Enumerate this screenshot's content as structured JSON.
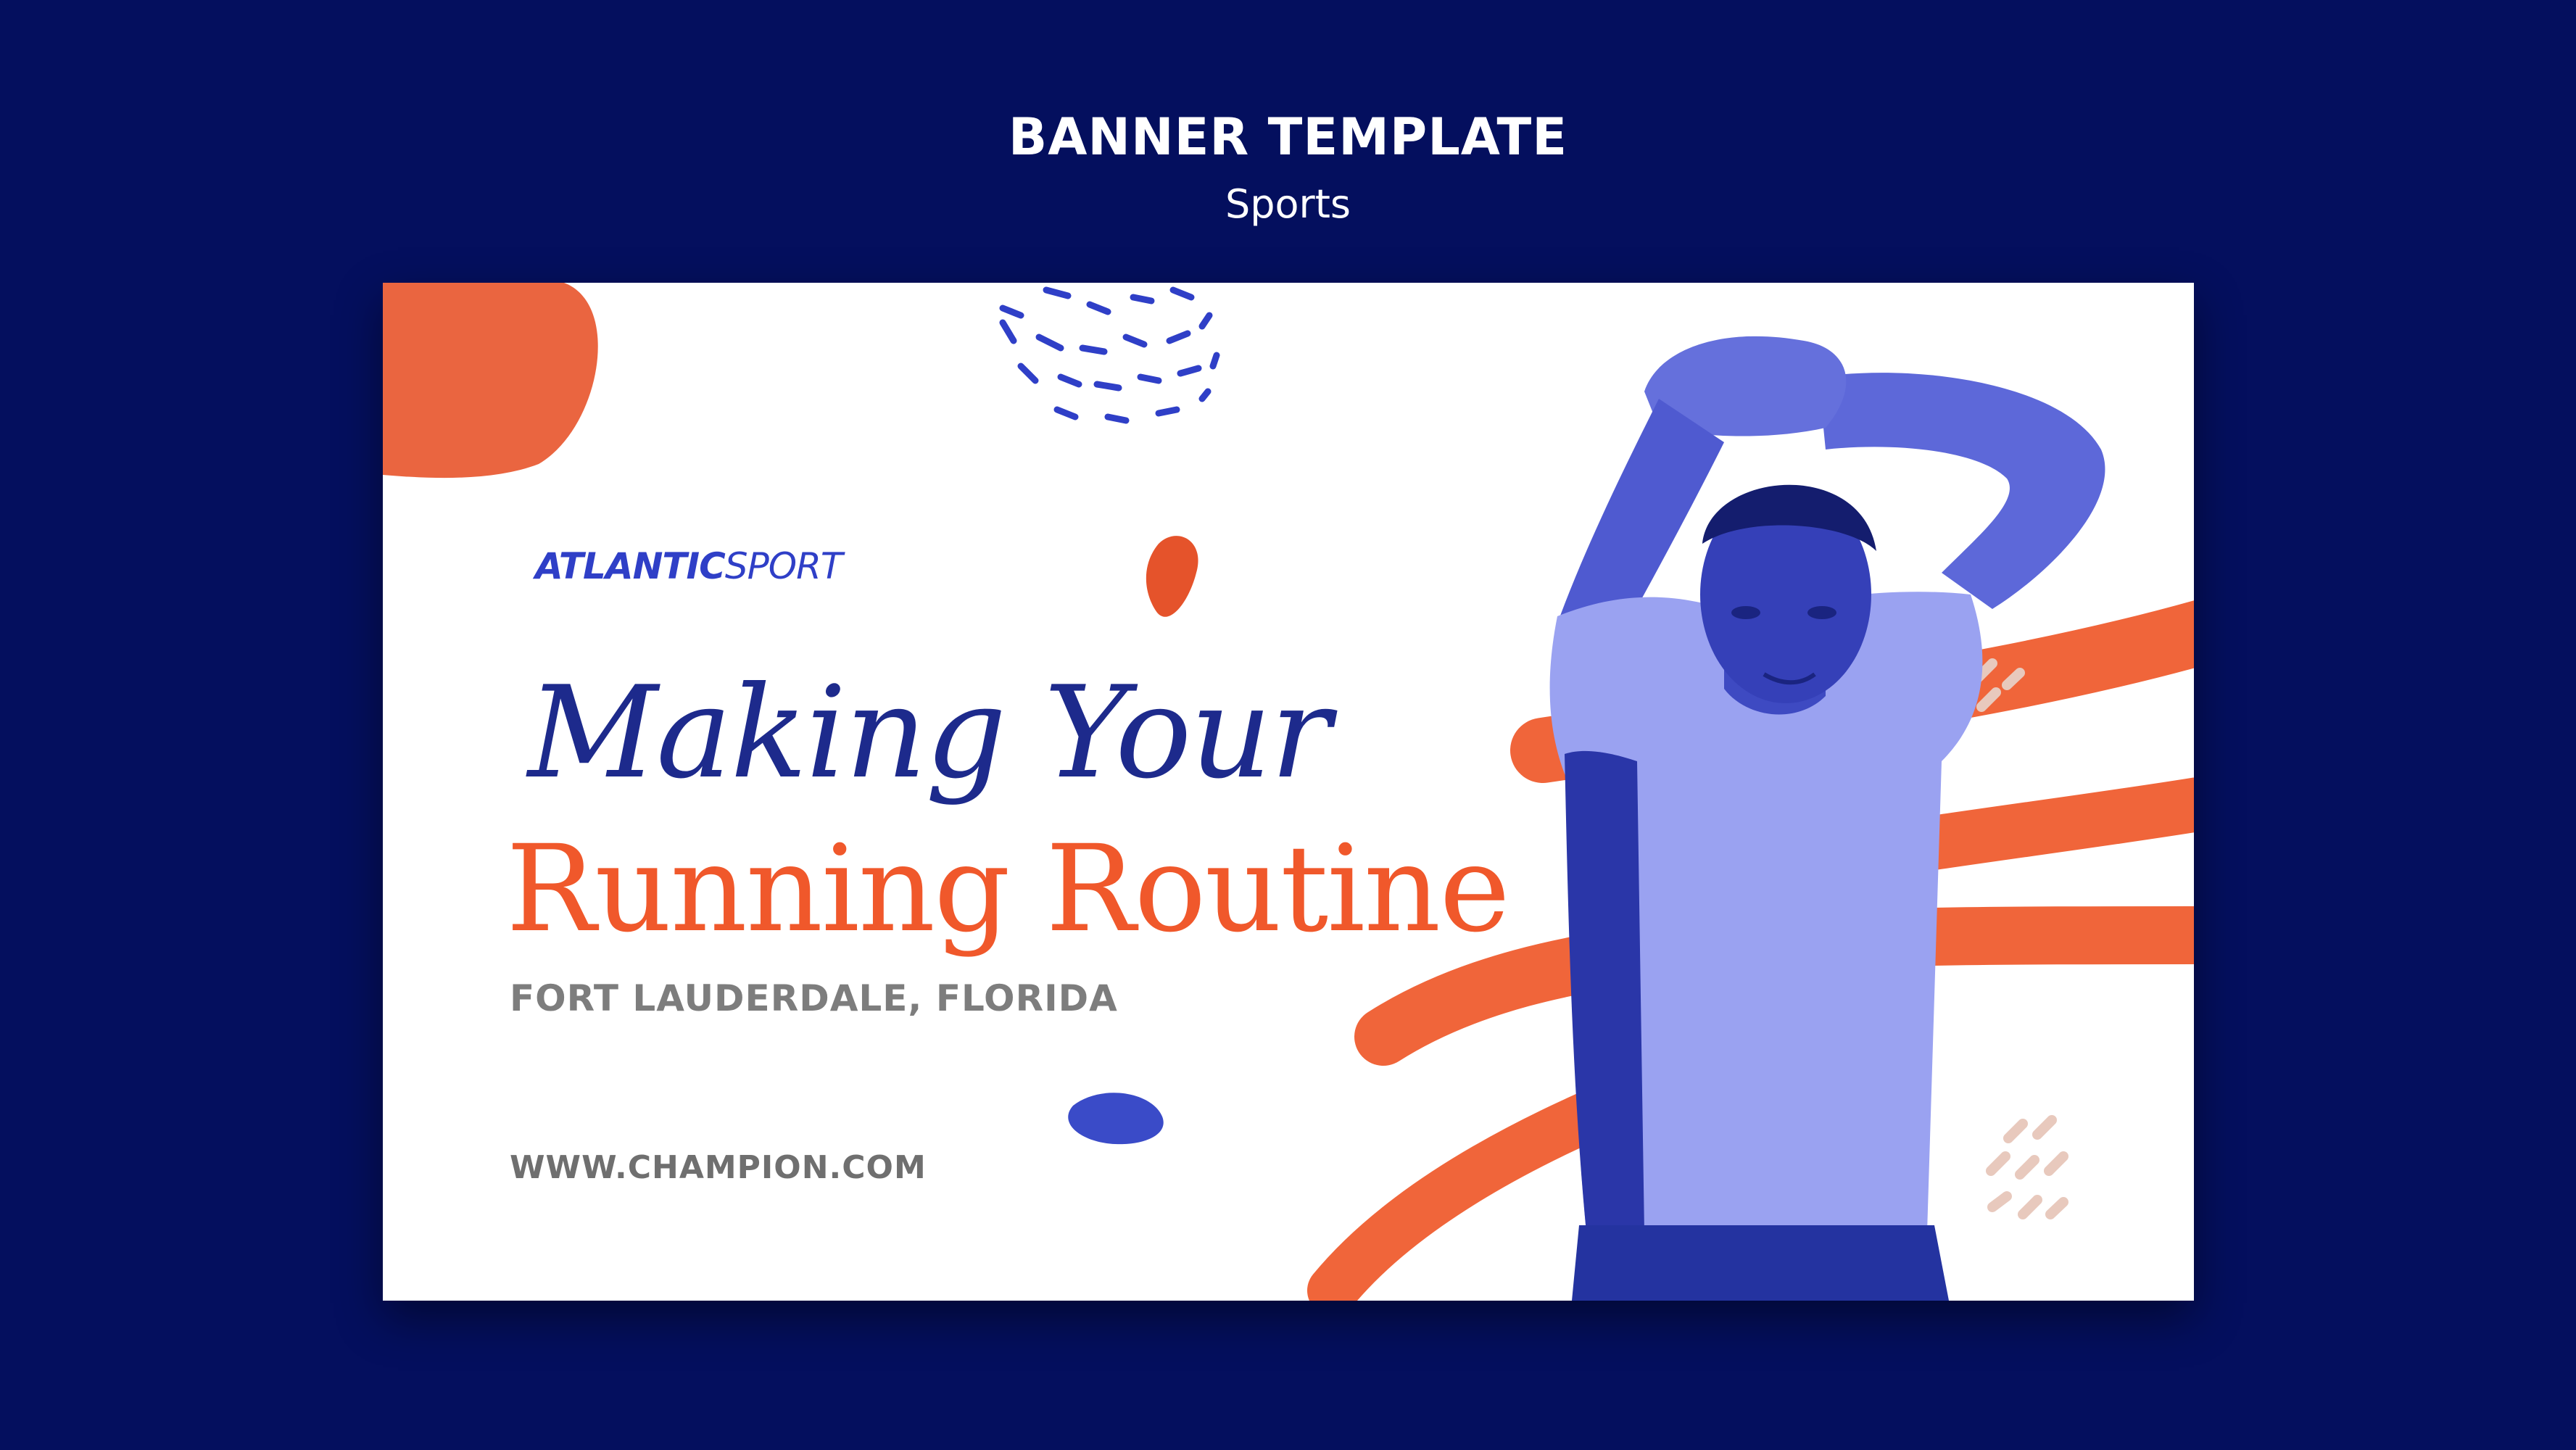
{
  "header": {
    "title": "BANNER TEMPLATE",
    "subtitle": "Sports"
  },
  "banner": {
    "brand_bold": "ATLANTIC",
    "brand_light": "SPORT",
    "headline_line1": "Making Your",
    "headline_line2": "Running Routine",
    "location": "FORT LAUDERDALE, FLORIDA",
    "website": "WWW.CHAMPION.COM"
  },
  "colors": {
    "page_background": "#040f5e",
    "banner_background": "#ffffff",
    "accent_orange": "#f0582b",
    "accent_blue": "#2f3fc7",
    "headline_navy": "#1d2a8c",
    "photo_tint": "#8f98ef"
  },
  "images": {
    "athlete_photo": "athlete-stretching-photo"
  }
}
